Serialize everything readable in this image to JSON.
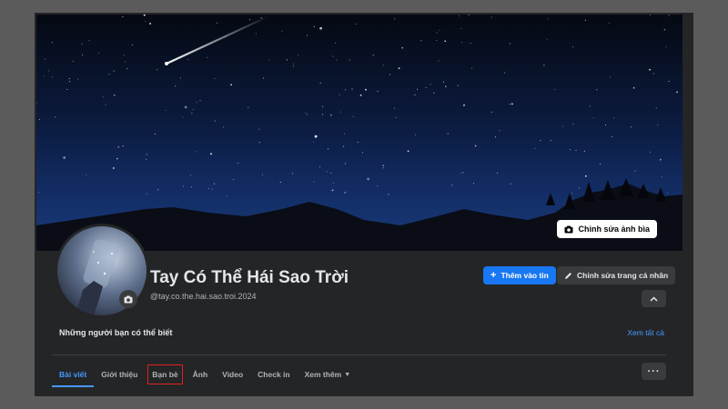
{
  "cover": {
    "edit_label": "Chỉnh sửa ảnh bìa",
    "icon": "camera-icon"
  },
  "profile": {
    "name": "Tay Có Thể Hái Sao Trời",
    "handle": "@tay.co.the.hai.sao.troi.2024"
  },
  "actions": {
    "add_story": "Thêm vào tin",
    "edit_profile": "Chỉnh sửa trang cá nhân"
  },
  "suggestions": {
    "title": "Những người bạn có thể biết",
    "see_all": "Xem tất cả"
  },
  "tabs": [
    {
      "label": "Bài viết"
    },
    {
      "label": "Giới thiệu"
    },
    {
      "label": "Bạn bè"
    },
    {
      "label": "Ảnh"
    },
    {
      "label": "Video"
    },
    {
      "label": "Check in"
    },
    {
      "label": "Xem thêm"
    }
  ],
  "colors": {
    "accent": "#1877f2",
    "link": "#4599ff",
    "highlight_box": "#e02020",
    "surface": "#242526"
  }
}
